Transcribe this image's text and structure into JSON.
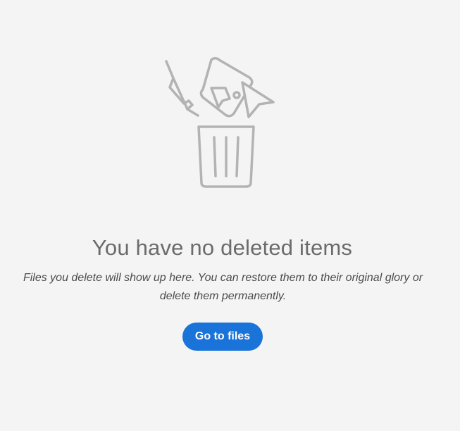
{
  "empty_state": {
    "illustration_icon": "trash-with-falling-files-icon",
    "title": "You have no deleted items",
    "description": "Files you delete will show up here. You can restore them to their original glory or delete them permanently.",
    "cta_label": "Go to files"
  },
  "colors": {
    "background": "#f4f4f4",
    "illustration_stroke": "#b3b3b3",
    "title": "#6b6b6b",
    "description": "#4b4b4b",
    "button": "#1a73d9",
    "button_text": "#ffffff"
  }
}
